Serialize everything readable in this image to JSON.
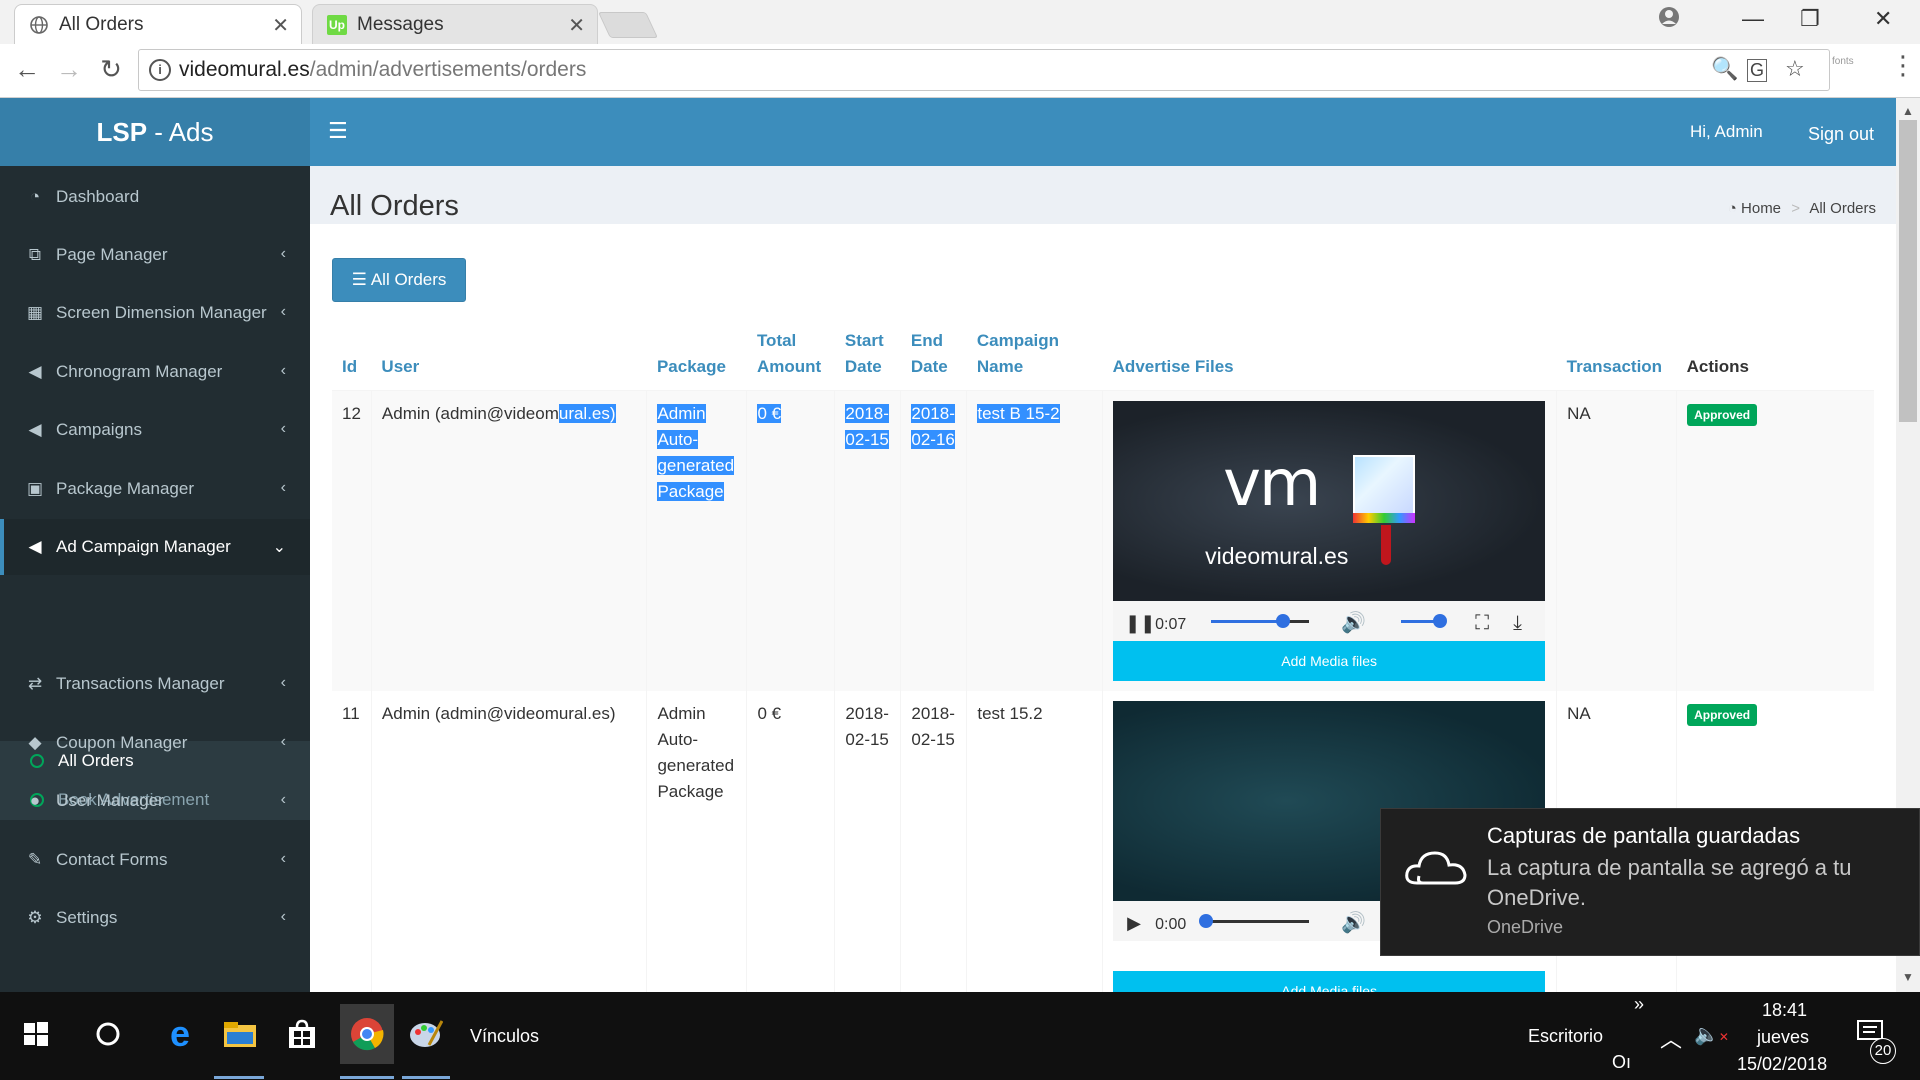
{
  "browser": {
    "tabs": [
      {
        "title": "All Orders",
        "active": true
      },
      {
        "title": "Messages",
        "active": false,
        "favicon_text": "Up"
      }
    ],
    "url_domain": "videomural.es",
    "url_path": "/admin/advertisements/orders",
    "extension_label": "fonts"
  },
  "app": {
    "logo_bold": "LSP",
    "logo_rest": " - Ads",
    "greeting": "Hi, Admin",
    "signout": "Sign out"
  },
  "sidebar": {
    "items": [
      {
        "label": "Dashboard",
        "icon": "dashboard-icon",
        "glyph": "◔",
        "chevron": false
      },
      {
        "label": "Page Manager",
        "icon": "pages-icon",
        "glyph": "⧉",
        "chevron": true
      },
      {
        "label": "Screen Dimension Manager",
        "icon": "grid-icon",
        "glyph": "▦",
        "chevron": true
      },
      {
        "label": "Chronogram Manager",
        "icon": "bullhorn-icon",
        "glyph": "📢",
        "chevron": true
      },
      {
        "label": "Campaigns",
        "icon": "bullhorn-icon",
        "glyph": "📢",
        "chevron": true
      },
      {
        "label": "Package Manager",
        "icon": "calendar-check-icon",
        "glyph": "🗓",
        "chevron": true
      },
      {
        "label": "Ad Campaign Manager",
        "icon": "bullhorn-icon",
        "glyph": "📢",
        "chevron": true,
        "active": true
      },
      {
        "label": "Transactions Manager",
        "icon": "exchange-icon",
        "glyph": "⇄",
        "chevron": true
      },
      {
        "label": "Coupon Manager",
        "icon": "tag-icon",
        "glyph": "🏷",
        "chevron": true
      },
      {
        "label": "User Manager",
        "icon": "user-icon",
        "glyph": "👤",
        "chevron": true
      },
      {
        "label": "Contact Forms",
        "icon": "edit-icon",
        "glyph": "✎",
        "chevron": true
      },
      {
        "label": "Settings",
        "icon": "gear-icon",
        "glyph": "⚙",
        "chevron": true
      }
    ],
    "submenu": [
      {
        "label": "All Orders",
        "current": true
      },
      {
        "label": "Book Advertisement",
        "current": false
      }
    ]
  },
  "page": {
    "title": "All Orders",
    "breadcrumb": {
      "home": "Home",
      "current": "All Orders"
    },
    "button_label": "All Orders"
  },
  "table": {
    "headers": {
      "id": "Id",
      "user": "User",
      "package": "Package",
      "total_amount": [
        "Total",
        "Amount"
      ],
      "start_date": [
        "Start",
        "Date"
      ],
      "end_date": [
        "End",
        "Date"
      ],
      "campaign_name": [
        "Campaign",
        "Name"
      ],
      "advertise_files": "Advertise Files",
      "transaction": "Transaction",
      "actions": "Actions"
    },
    "rows": [
      {
        "id": "12",
        "user_plain": "Admin (admin@videom",
        "user_selected": "ural.es)",
        "package": [
          "Admin",
          "Auto-",
          "generated",
          "Package"
        ],
        "total": "0 €",
        "start": [
          "2018-",
          "02-15"
        ],
        "end": [
          "2018-",
          "02-16"
        ],
        "campaign": "test B 15-2",
        "media": {
          "time": "0:07",
          "logo_text": "vm",
          "brand_text": "videomural.es",
          "progress": 0.74,
          "volume": 0.85,
          "playing": true
        },
        "add_media": "Add Media files",
        "transaction": "NA",
        "status": "Approved"
      },
      {
        "id": "11",
        "user_plain": "Admin (admin@videomural.es)",
        "package": [
          "Admin",
          "Auto-",
          "generated",
          "Package"
        ],
        "total": "0 €",
        "start": [
          "2018-",
          "02-15"
        ],
        "end": [
          "2018-",
          "02-15"
        ],
        "campaign": "test 15.2",
        "media": {
          "time": "0:00",
          "progress": 0.0,
          "playing": false
        },
        "add_media": "Add Media files",
        "transaction": "NA",
        "status": "Approved"
      }
    ]
  },
  "toast": {
    "title": "Capturas de pantalla guardadas",
    "body": "La captura de pantalla se agregó a tu OneDrive.",
    "source": "OneDrive"
  },
  "taskbar": {
    "links_label": "Vínculos",
    "desktop_label": "Escritorio",
    "overflow_glyph": "»",
    "time": "18:41",
    "day": "jueves",
    "date": "15/02/2018",
    "notification_count": "20",
    "ime_text": "Oı"
  },
  "colors": {
    "navbar": "#3c8dbc",
    "logo_bg": "#367fa9",
    "sidebar_bg": "#222d32",
    "badge_green": "#00a65a",
    "add_media_cyan": "#00c0ef",
    "selection_blue": "#3390ff"
  }
}
